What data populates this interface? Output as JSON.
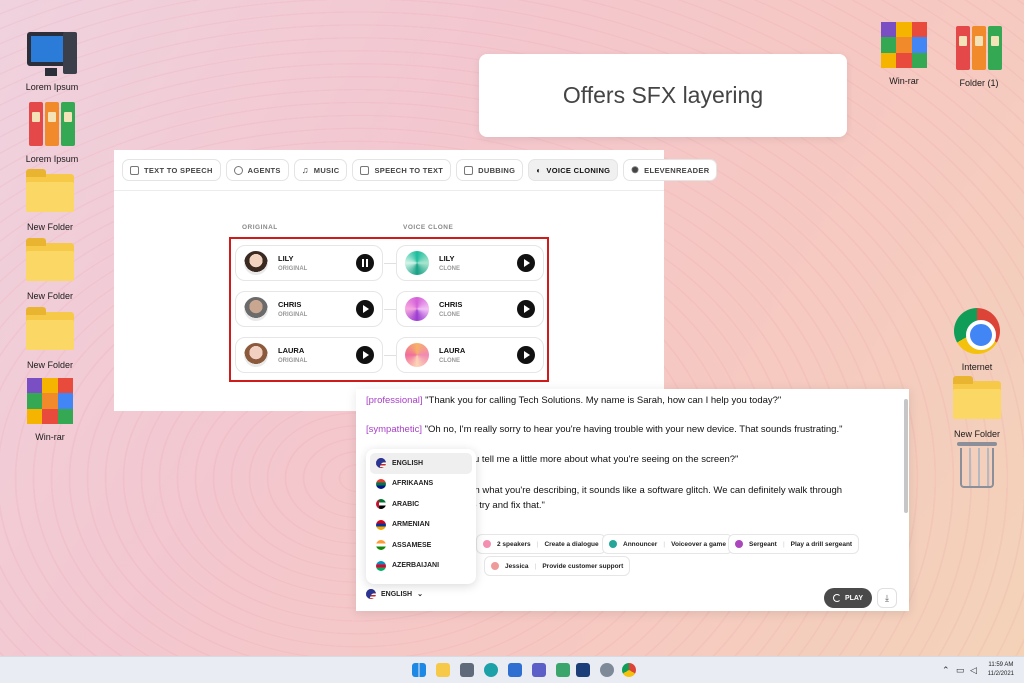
{
  "caption": "Offers SFX layering",
  "desktop_left": [
    {
      "label": "Lorem Ipsum",
      "icon": "computer-icon"
    },
    {
      "label": "Lorem Ipsum",
      "icon": "binders-icon"
    },
    {
      "label": "New Folder",
      "icon": "folder-icon"
    },
    {
      "label": "New Folder",
      "icon": "folder-icon"
    },
    {
      "label": "New Folder",
      "icon": "folder-icon"
    },
    {
      "label": "Win-rar",
      "icon": "winrar-icon"
    }
  ],
  "desktop_right": [
    {
      "label": "Win-rar",
      "icon": "winrar-icon"
    },
    {
      "label": "Folder (1)",
      "icon": "binders-icon"
    },
    {
      "label": "Internet",
      "icon": "chrome-icon"
    },
    {
      "label": "New Folder",
      "icon": "folder-icon"
    },
    {
      "label": "",
      "icon": "trash-icon"
    }
  ],
  "tabs": [
    "TEXT TO SPEECH",
    "AGENTS",
    "MUSIC",
    "SPEECH TO TEXT",
    "DUBBING",
    "VOICE CLONING",
    "ELEVENREADER"
  ],
  "active_tab": "VOICE CLONING",
  "columns": {
    "original": "ORIGINAL",
    "clone": "VOICE CLONE"
  },
  "voices": [
    {
      "name": "LILY",
      "original_sub": "ORIGINAL",
      "clone_sub": "CLONE",
      "state": "playing"
    },
    {
      "name": "CHRIS",
      "original_sub": "ORIGINAL",
      "clone_sub": "CLONE",
      "state": "paused"
    },
    {
      "name": "LAURA",
      "original_sub": "ORIGINAL",
      "clone_sub": "CLONE",
      "state": "paused"
    }
  ],
  "editor": {
    "line1_tag": "[professional]",
    "line1_text": " \"Thank you for calling Tech Solutions. My name is Sarah, how can I help you today?\"",
    "line2_tag": "[sympathetic]",
    "line2_text": " \"Oh no, I'm really sorry to hear you're having trouble with your new device. That sounds frustrating.\"",
    "line3_text": "d you tell me a little more about what you're seeing on the screen?\"",
    "line4_text": "ed on what you're describing, it sounds like a software glitch. We can definitely walk through",
    "line5_text": "ps to try and fix that.\""
  },
  "pills": [
    {
      "name": "2 speakers",
      "action": "Create a dialogue",
      "color": "#f48fb1"
    },
    {
      "name": "Announcer",
      "action": "Voiceover a game",
      "color": "#26a69a"
    },
    {
      "name": "Sergeant",
      "action": "Play a drill sergeant",
      "color": "#ab47bc"
    },
    {
      "name": "Jessica",
      "action": "Provide customer support",
      "color": "#ef9a9a"
    }
  ],
  "languages": [
    "ENGLISH",
    "AFRIKAANS",
    "ARABIC",
    "ARMENIAN",
    "ASSAMESE",
    "AZERBAIJANI"
  ],
  "selected_language": "ENGLISH",
  "play_label": "PLAY",
  "clock": {
    "time": "11:59 AM",
    "date": "11/2/2021"
  }
}
